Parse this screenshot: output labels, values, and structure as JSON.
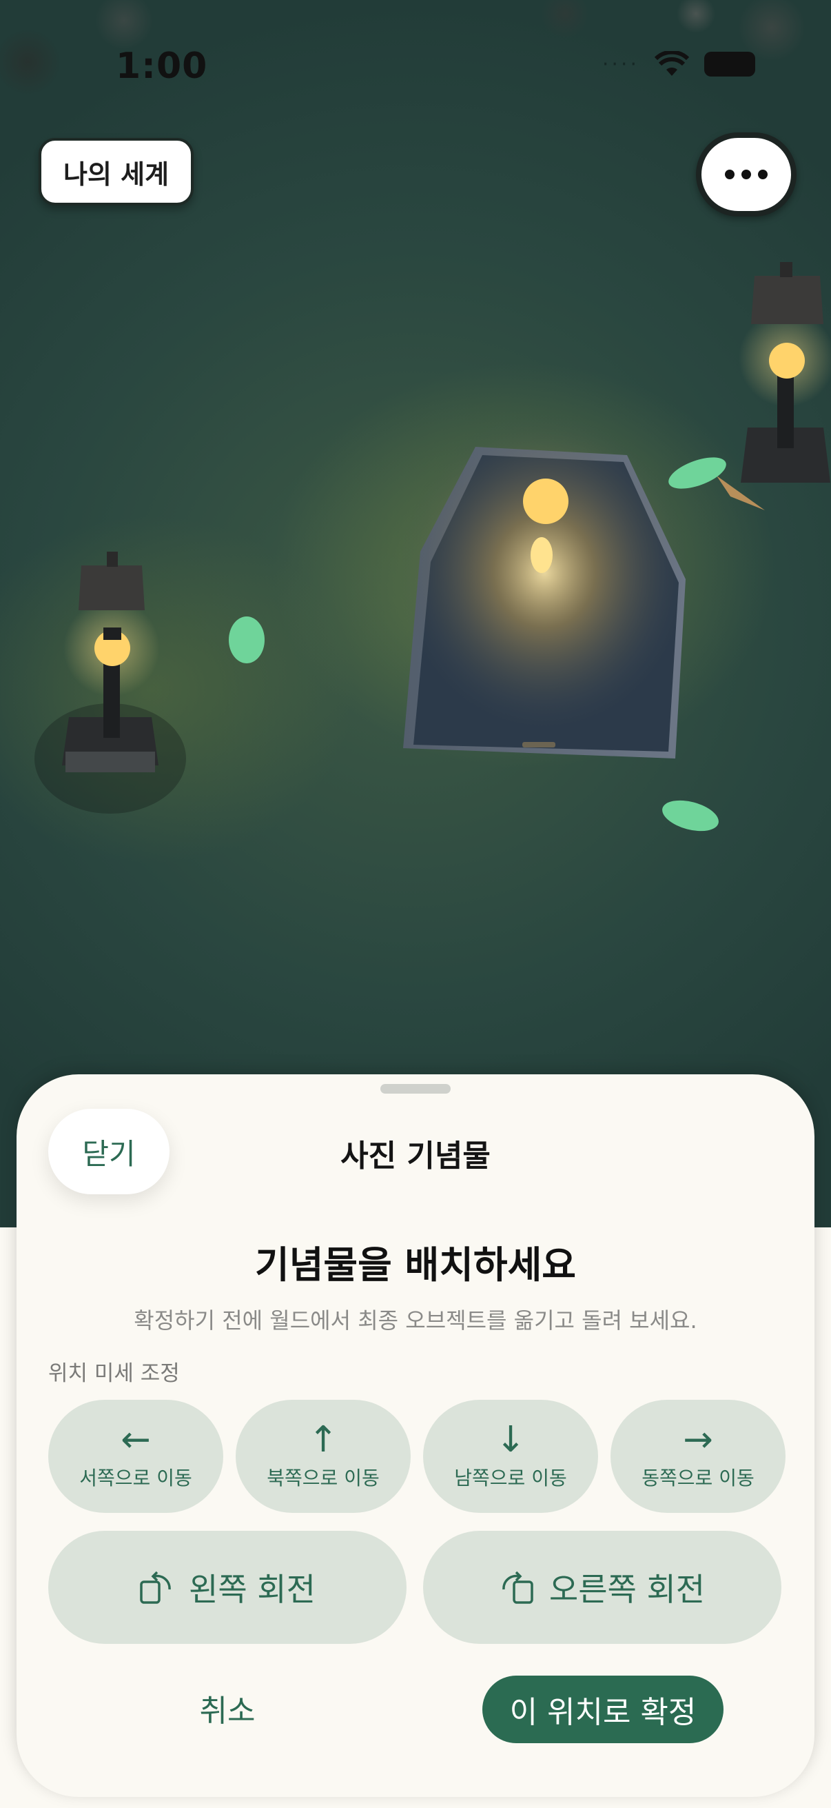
{
  "status_bar": {
    "time": "1:00",
    "signal": "····"
  },
  "header": {
    "world_button": "나의 세계",
    "more_icon": "more-horizontal-icon"
  },
  "sheet": {
    "close": "닫기",
    "title": "사진 기념물",
    "headline": "기념물을 배치하세요",
    "subtext": "확정하기 전에 월드에서 최종 오브젝트를 옮기고 돌려 보세요.",
    "section_label": "위치 미세 조정",
    "move_buttons": [
      {
        "icon": "arrow-left-icon",
        "arrow": "←",
        "label": "서쪽으로 이동"
      },
      {
        "icon": "arrow-up-icon",
        "arrow": "↑",
        "label": "북쪽으로 이동"
      },
      {
        "icon": "arrow-down-icon",
        "arrow": "↓",
        "label": "남쪽으로 이동"
      },
      {
        "icon": "arrow-right-icon",
        "arrow": "→",
        "label": "동쪽으로 이동"
      }
    ],
    "rotate_left": "왼쪽 회전",
    "rotate_right": "오른쪽 회전",
    "cancel": "취소",
    "confirm": "이 위치로 확정"
  },
  "colors": {
    "accent": "#2b6b52",
    "button_bg": "#dbe3da",
    "sheet_bg": "#fbf9f3",
    "scene_bg": "#2a4740",
    "lamp_glow": "#ffd36b",
    "leaf": "#6fd49a"
  }
}
